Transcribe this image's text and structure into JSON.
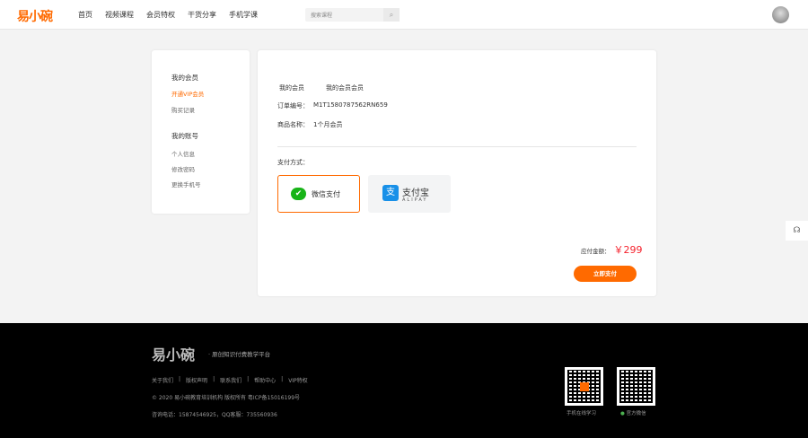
{
  "header": {
    "logo": "易小碗",
    "nav": [
      "首页",
      "视频课程",
      "会员特权",
      "干货分享",
      "手机学课"
    ],
    "search_placeholder": "搜索课程"
  },
  "sidebar": {
    "group1": "我的会员",
    "items1": [
      "开通VIP会员",
      "购买记录"
    ],
    "group2": "我的账号",
    "items2": [
      "个人信息",
      "修改密码",
      "更换手机号"
    ]
  },
  "main": {
    "breadcrumb": [
      "我的会员",
      "我的会员会员"
    ],
    "order_label": "订单编号：",
    "order_no": "M1T1580787562RN659",
    "product_label": "商品名称：",
    "product": "1个月会员",
    "pay_method_label": "支付方式：",
    "wechat_pay": "微信支付",
    "alipay": "支付宝",
    "alipay_en": "ALIPAY",
    "amount_label": "应付金额：",
    "amount": "￥299",
    "pay_button": "立即支付"
  },
  "footer": {
    "logo": "易小碗",
    "slogan": "· 原创知识付费教学平台",
    "links": [
      "关于我们",
      "|",
      "版权声明",
      "|",
      "联系我们",
      "|",
      "帮助中心",
      "|",
      "VIP特权"
    ],
    "copyright": "© 2020 易小碗教育培训机构 版权所有 粤ICP备15016199号",
    "contact": "咨询电话：15874546925，QQ客服：735560936",
    "qr1": "手机在线学习",
    "qr2": "官方微信"
  },
  "colors": {
    "accent": "#ff6a00",
    "price": "#f5222d"
  }
}
